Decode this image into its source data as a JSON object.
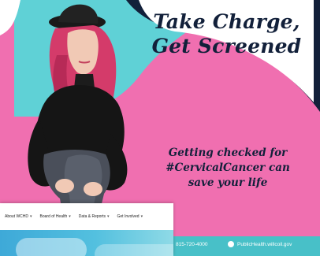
{
  "banner": {
    "headline": [
      "Take Charge,",
      "Get Screened"
    ],
    "message": [
      "Getting checked for",
      "#CervicalCancer can",
      "save your life"
    ],
    "colors": {
      "pink": "#f06fb0",
      "teal": "#5fd1d6",
      "navy": "#12203a"
    }
  },
  "footer": {
    "phone": "815-720-4000",
    "website": "PublicHealth.willcoil.gov"
  },
  "site_nav": {
    "items": [
      {
        "label": "About WCHD"
      },
      {
        "label": "Board of Health"
      },
      {
        "label": "Data & Reports"
      },
      {
        "label": "Get Involved"
      }
    ]
  }
}
